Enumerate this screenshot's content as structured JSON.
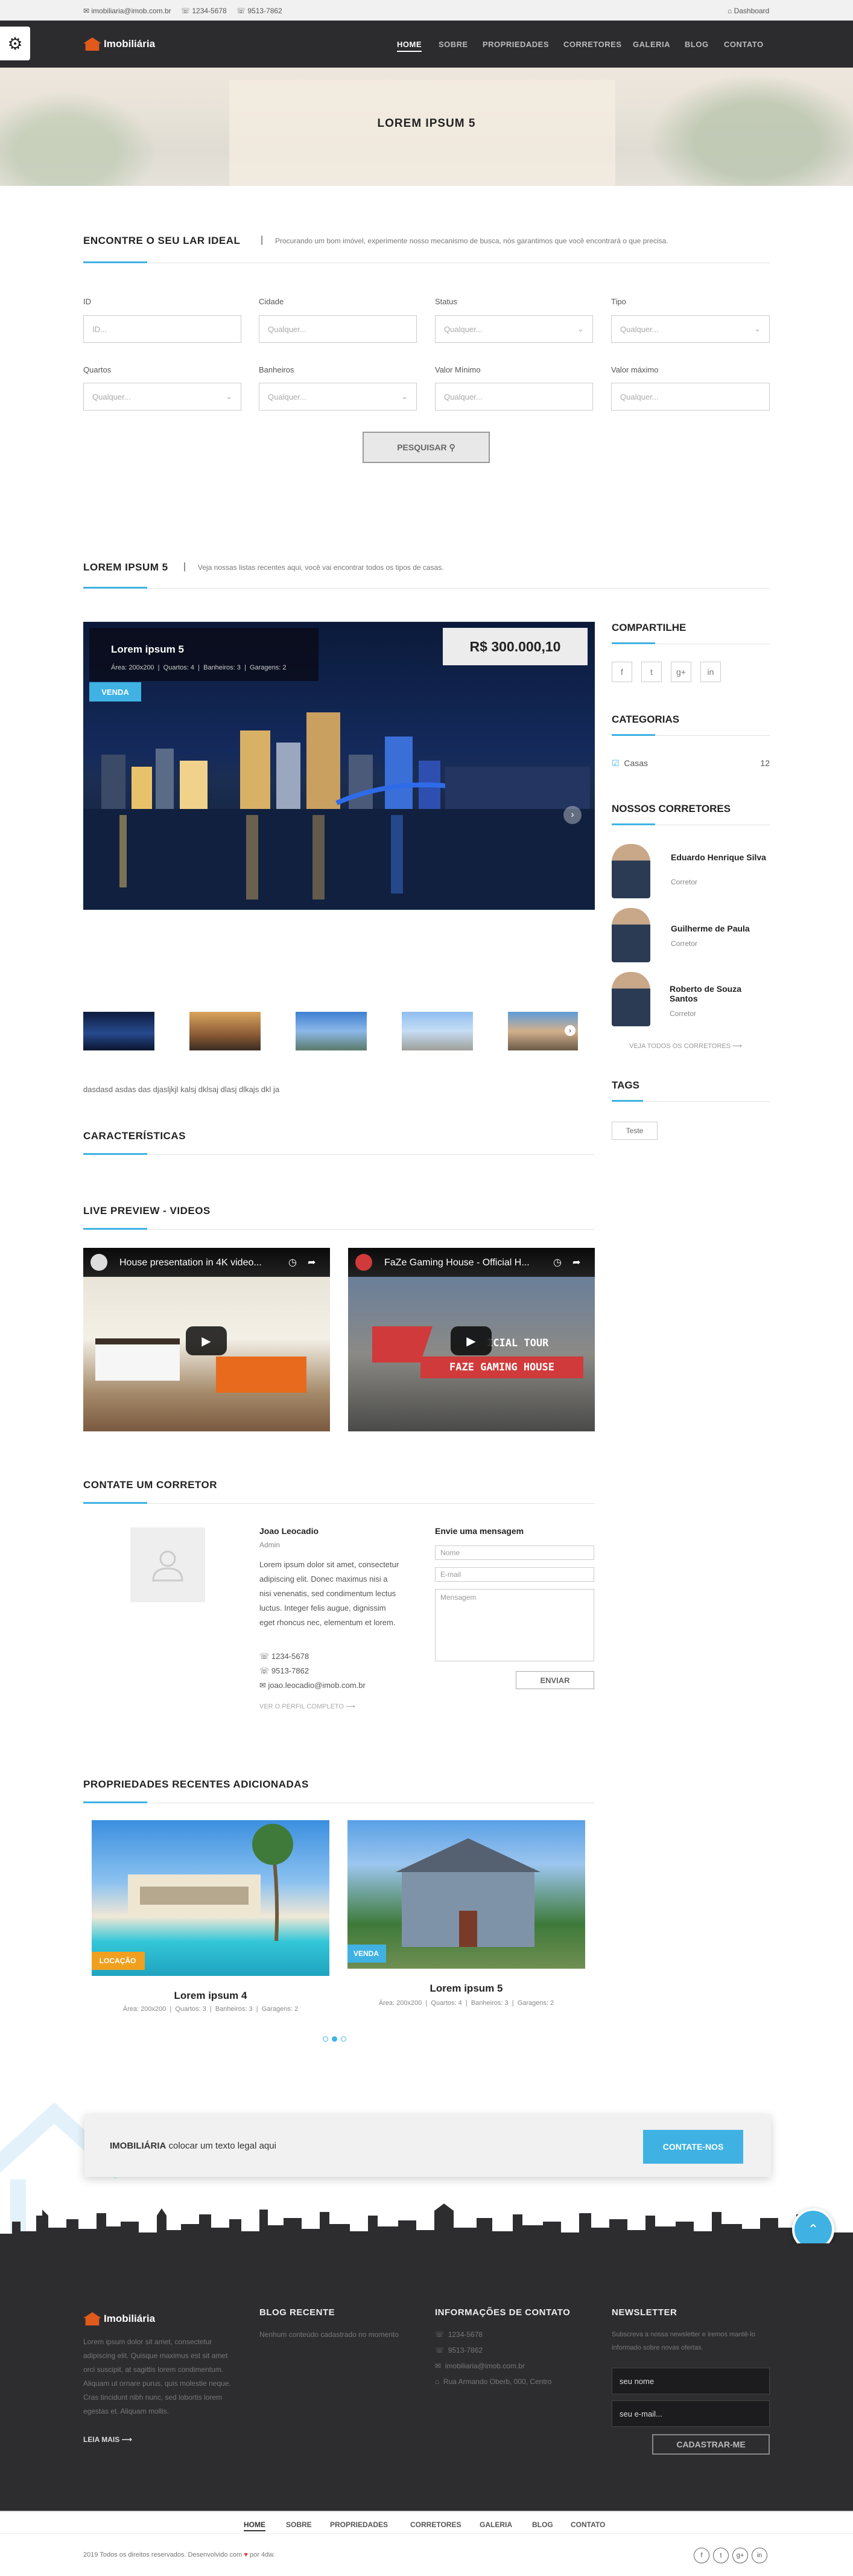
{
  "topbar": {
    "email": "imobiliaria@imob.com.br",
    "phone1": "1234-5678",
    "phone2": "9513-7862",
    "dashboard": "Dashboard"
  },
  "header": {
    "logo_text": "Imobiliária",
    "menu": [
      "HOME",
      "SOBRE",
      "PROPRIEDADES",
      "CORRETORES",
      "GALERIA",
      "BLOG",
      "CONTATO"
    ]
  },
  "hero": {
    "title": "LOREM IPSUM 5"
  },
  "search": {
    "title": "ENCONTRE O SEU LAR IDEAL",
    "subtitle": "Procurando um bom imóvel, experimente nosso mecanismo de busca, nós garantimos que você encontrará o que precisa.",
    "fields": [
      {
        "label": "ID",
        "placeholder": "ID..."
      },
      {
        "label": "Cidade",
        "placeholder": "Qualquer..."
      },
      {
        "label": "Status",
        "placeholder": "Qualquer..."
      },
      {
        "label": "Tipo",
        "placeholder": "Qualquer..."
      },
      {
        "label": "Quartos",
        "placeholder": "Qualquer..."
      },
      {
        "label": "Banheiros",
        "placeholder": "Qualquer..."
      },
      {
        "label": "Valor Mínimo",
        "placeholder": "Qualquer..."
      },
      {
        "label": "Valor máximo",
        "placeholder": "Qualquer..."
      }
    ],
    "button": "PESQUISAR"
  },
  "listing": {
    "title": "LOREM IPSUM 5",
    "subtitle": "Veja nossas listas recentes aqui, você vai encontrar todos os tipos de casas.",
    "property_name": "Lorem ipsum 5",
    "details": [
      "Área: 200x200",
      "Quartos: 4",
      "Banheiros: 3",
      "Garagens: 2"
    ],
    "price": "R$ 300.000,10",
    "status": "VENDA",
    "description": "dasdasd asdas das djasljkjl kalsj dklsaj dlasj dlkajs dkl ja",
    "features_title": "CARACTERÍSTICAS",
    "videos_title": "LIVE PREVIEW - VIDEOS",
    "videos": [
      {
        "title": "House presentation in 4K video..."
      },
      {
        "title": "FaZe Gaming House - Official H...",
        "overlay": "FAZE GAMING HOUSE",
        "overlay2": "ICIAL TOUR"
      }
    ]
  },
  "sidebar": {
    "share_title": "COMPARTILHE",
    "share_icons": [
      "f",
      "t",
      "g+",
      "in"
    ],
    "categories_title": "CATEGORIAS",
    "categories": [
      {
        "name": "Casas",
        "count": "12"
      }
    ],
    "agents_title": "NOSSOS CORRETORES",
    "agents": [
      {
        "name": "Eduardo Henrique Silva",
        "role": "Corretor"
      },
      {
        "name": "Guilherme de Paula",
        "role": "Corretor"
      },
      {
        "name": "Roberto de Souza Santos",
        "role": "Corretor"
      }
    ],
    "agents_link": "VEJA TODOS OS CORRETORES",
    "tags_title": "TAGS",
    "tags": [
      "Teste"
    ]
  },
  "contact": {
    "title": "CONTATE UM CORRETOR",
    "agent_name": "Joao Leocadio",
    "agent_role": "Admin",
    "agent_bio": "Lorem ipsum dolor sit amet, consectetur adipiscing elit. Donec maximus nisi a nisi venenatis, sed condimentum lectus luctus. Integer felis augue, dignissim eget rhoncus nec, elementum et lorem.",
    "phone1": "1234-5678",
    "phone2": "9513-7862",
    "email": "joao.leocadio@imob.com.br",
    "profile_link": "VER O PERFIL COMPLETO",
    "form_title": "Envie uma mensagem",
    "name_placeholder": "Nome",
    "email_placeholder": "E-mail",
    "message_placeholder": "Mensagem",
    "send": "ENVIAR"
  },
  "recent": {
    "title": "PROPRIEDADES RECENTES ADICIONADAS",
    "items": [
      {
        "name": "Lorem ipsum 4",
        "status": "LOCAÇÃO",
        "details": [
          "Área: 200x200",
          "Quartos: 3",
          "Banheiros: 3",
          "Garagens: 2"
        ]
      },
      {
        "name": "Lorem ipsum 5",
        "status": "VENDA",
        "details": [
          "Área: 200x200",
          "Quartos: 4",
          "Banheiros: 3",
          "Garagens: 2"
        ]
      }
    ]
  },
  "cta": {
    "brand": "IMOBILIÁRIA",
    "text": "colocar um texto legal aqui",
    "button": "CONTATE-NOS"
  },
  "footer": {
    "logo_text": "Imobiliária",
    "about": "Lorem ipsum dolor sit amet, consectetur adipiscing elit. Quisque maximus est sit amet orci suscipit, at sagittis lorem condimentum. Aliquam ut ornare purus, quis molestie neque. Cras tincidunt nibh nunc, sed lobortis lorem egestas et. Aliquam mollis.",
    "read_more": "LEIA MAIS",
    "blog_title": "BLOG RECENTE",
    "blog_empty": "Nenhum conteúdo cadastrado no momento",
    "info_title": "INFORMAÇÕES DE CONTATO",
    "info": [
      "1234-5678",
      "9513-7862",
      "imobiliaria@imob.com.br",
      "Rua Armando Oberb, 000, Centro"
    ],
    "newsletter_title": "NEWSLETTER",
    "newsletter_text": "Subscreva a nossa newsletter e iremos mantê-lo informado sobre novas ofertas.",
    "name_value": "seu nome",
    "email_value": "seu e-mail...",
    "subscribe": "CADASTRAR-ME"
  },
  "bottom": {
    "menu": [
      "HOME",
      "SOBRE",
      "PROPRIEDADES",
      "CORRETORES",
      "GALERIA",
      "BLOG",
      "CONTATO"
    ],
    "copyright": "2019 Todos os direitos reservados. Desenvolvido com",
    "by": "por 4dw."
  },
  "colors": {
    "accent": "#3fb2e3",
    "dark": "#2d2d30",
    "orange": "#f0a01e"
  }
}
